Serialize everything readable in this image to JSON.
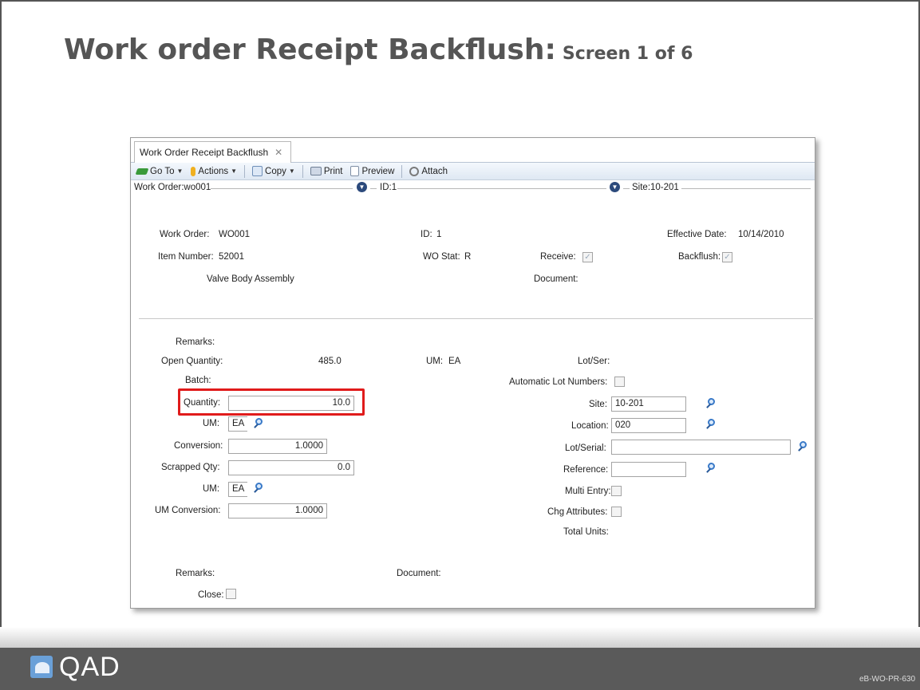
{
  "slide": {
    "title": "Work order Receipt Backflush:",
    "subtitle": "Screen 1 of 6",
    "logo_text": "QAD",
    "code": "eB-WO-PR-630"
  },
  "window": {
    "tab_label": "Work Order Receipt Backflush",
    "tab_close": "✕",
    "toolbar": {
      "goto": "Go To",
      "actions": "Actions",
      "copy": "Copy",
      "print": "Print",
      "preview": "Preview",
      "attach": "Attach"
    },
    "header": {
      "work_order": "Work Order:wo001",
      "id": "ID:1",
      "site": "Site:10-201"
    },
    "top": {
      "work_order_label": "Work Order:",
      "work_order_value": "WO001",
      "id_label": "ID:",
      "id_value": "1",
      "effective_date_label": "Effective Date:",
      "effective_date_value": "10/14/2010",
      "item_number_label": "Item Number:",
      "item_number_value": "52001",
      "wo_stat_label": "WO Stat:",
      "wo_stat_value": "R",
      "receive_label": "Receive:",
      "backflush_label": "Backflush:",
      "description": "Valve Body Assembly",
      "document_label": "Document:"
    },
    "detail": {
      "remarks_label": "Remarks:",
      "open_qty_label": "Open Quantity:",
      "open_qty_value": "485.0",
      "um_label_top": "UM:",
      "um_value_top": "EA",
      "lot_ser_label": "Lot/Ser:",
      "batch_label": "Batch:",
      "auto_lot_label": "Automatic Lot Numbers:",
      "quantity_label": "Quantity:",
      "quantity_value": "10.0",
      "site_label": "Site:",
      "site_value": "10-201",
      "um_label": "UM:",
      "um_value": "EA",
      "location_label": "Location:",
      "location_value": "020",
      "conversion_label": "Conversion:",
      "conversion_value": "1.0000",
      "lot_serial_label": "Lot/Serial:",
      "lot_serial_value": "",
      "scrapped_label": "Scrapped Qty:",
      "scrapped_value": "0.0",
      "reference_label": "Reference:",
      "reference_value": "",
      "um2_label": "UM:",
      "um2_value": "EA",
      "multi_entry_label": "Multi Entry:",
      "um_conv_label": "UM Conversion:",
      "um_conv_value": "1.0000",
      "chg_attr_label": "Chg Attributes:",
      "total_units_label": "Total Units:",
      "remarks2_label": "Remarks:",
      "document2_label": "Document:",
      "close_label": "Close:"
    },
    "checkbox_mark": "✓"
  },
  "colors": {
    "highlight": "#e01b1b",
    "title_gray": "#555555",
    "footer": "#5a5a5a"
  }
}
